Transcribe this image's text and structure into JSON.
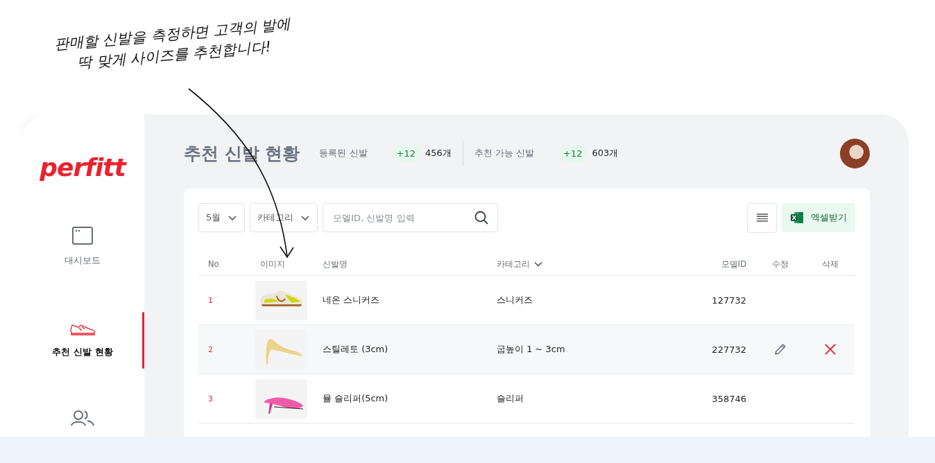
{
  "annotation": {
    "lines": [
      "판매할 신발을 측정하면 고객의 발에",
      "딱 맞게 사이즈를 추천합니다!"
    ]
  },
  "sidebar": {
    "logo": "perfitt",
    "items": [
      {
        "label": "대시보드",
        "selected": false
      },
      {
        "label": "추천 신발 현황",
        "selected": true
      },
      {
        "selected": false
      }
    ]
  },
  "header": {
    "title": "추천 신발 현황",
    "stats": [
      {
        "label": "등록된 신발",
        "delta": "+12",
        "count": "456개"
      },
      {
        "label": "추천 가능 신발",
        "delta": "+12",
        "count": "603개"
      }
    ]
  },
  "filters": {
    "month": "5월",
    "category": "카테고리",
    "search": {
      "placeholder": "모델ID, 신발명 입력"
    },
    "excel_button": "엑셀받기"
  },
  "table": {
    "columns": [
      {
        "label": "No",
        "sortable": false
      },
      {
        "label": "이미지",
        "sortable": false
      },
      {
        "label": "신발명",
        "sortable": false
      },
      {
        "label": "카테고리",
        "sortable": true
      },
      {
        "label": "모델ID",
        "sortable": false
      },
      {
        "label": "수정",
        "sortable": false
      },
      {
        "label": "삭제",
        "sortable": false
      }
    ],
    "rows": [
      {
        "no": "1",
        "name": "네온 스니커즈",
        "category": "스니커즈",
        "model_id": "127732",
        "highlighted": false
      },
      {
        "no": "2",
        "name": "스틸레토 (3cm)",
        "category": "굽높이 1 ~ 3cm",
        "model_id": "227732",
        "highlighted": true
      },
      {
        "no": "3",
        "name": "뮬 슬리퍼(5cm)",
        "category": "슬리퍼",
        "model_id": "358746",
        "highlighted": false
      }
    ]
  }
}
